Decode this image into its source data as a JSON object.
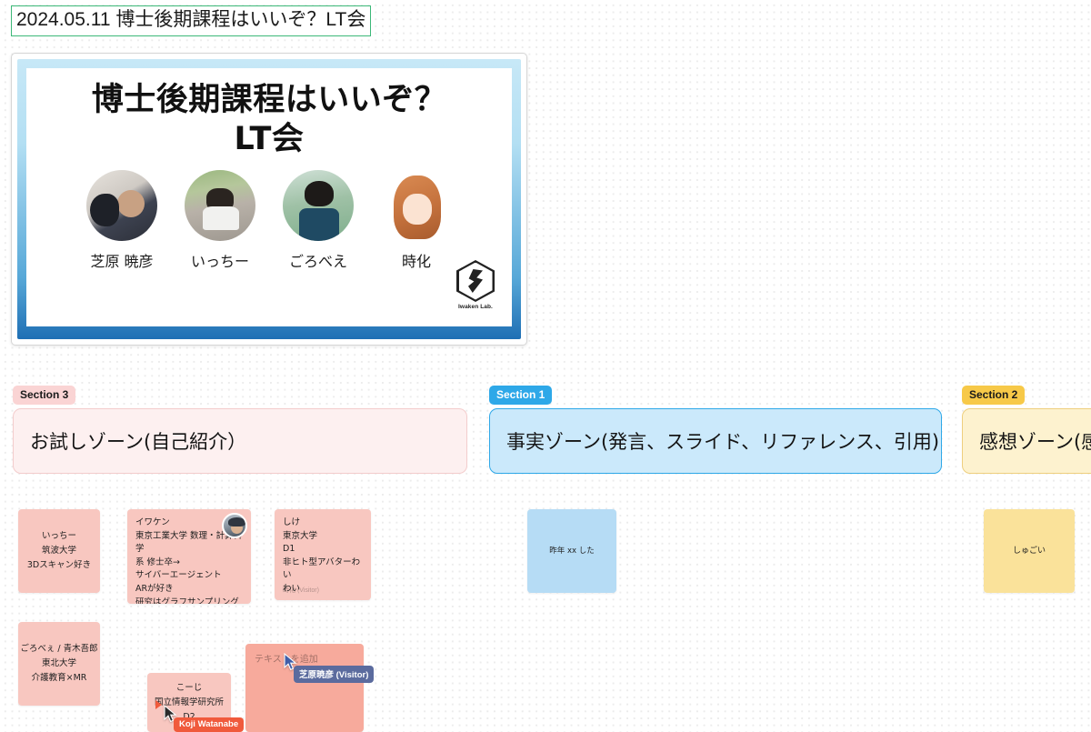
{
  "board": {
    "title": "2024.05.11 博士後期課程はいいぞ？LT会",
    "title_border_color": "#3cb878",
    "canvas_background": "#ffffff",
    "grid_dot_color": "#ececec"
  },
  "slide": {
    "title_line1": "博士後期課程はいいぞ？",
    "title_line2": "LT会",
    "frame_color": "#1f6fb4",
    "people": [
      {
        "name": "芝原 暁彦",
        "avatar_icon": "photo-avatar-shibahara"
      },
      {
        "name": "いっちー",
        "avatar_icon": "photo-avatar-icchi"
      },
      {
        "name": "ごろべえ",
        "avatar_icon": "photo-avatar-gorobe"
      },
      {
        "name": "時化",
        "avatar_icon": "illustration-avatar-shike"
      }
    ],
    "logo": {
      "name": "Iwaken Lab.",
      "icon": "iwaken-lab-hexagon-logo"
    }
  },
  "sections": [
    {
      "tag": "Section 3",
      "tag_color": "#fad4d4",
      "zone_label": "お試しゾーン(自己紹介）",
      "zone_fill": "#fdf0f0",
      "zone_border": "#f3cccc"
    },
    {
      "tag": "Section 1",
      "tag_color": "#2ea8e8",
      "zone_label": "事実ゾーン(発言、スライド、リファレンス、引用)",
      "zone_fill": "#cbe9fb",
      "zone_border": "#2ea8e8"
    },
    {
      "tag": "Section 2",
      "tag_color": "#f7c948",
      "zone_label": "感想ゾーン(感",
      "zone_fill": "#fdf2cf",
      "zone_border": "#eecf7e"
    }
  ],
  "notes": {
    "icchi": {
      "text": "いっちー\n筑波大学\n3Dスキャン好き",
      "color": "#f8c7c0"
    },
    "iwaken": {
      "text": "イワケン\n東京工業大学 数理・計算科学\n系 修士卒→\nサイバーエージェント\nARが好き\n研究はグラフサンプリング\n研究はプチ挫折で会社員に！",
      "color": "#f8c7c0",
      "avatar_icon": "iwaken-profile-avatar"
    },
    "shike": {
      "text": "しけ\n東京大学\nD1\n非ヒト型アバターわい\nわい",
      "author": "時化 (Visitor)",
      "color": "#f8c7c0"
    },
    "gorobe": {
      "text": "ごろべぇ / 青木吾郎\n東北大学\n介護教育×MR",
      "color": "#f8c7c0"
    },
    "koji": {
      "text": "こーじ\n国立情報学研究所\nD2",
      "color": "#f8c7c0"
    },
    "new_text": {
      "placeholder": "テキストを追加",
      "color": "#f7aa9c"
    },
    "sakunen": {
      "text": "昨年 xx した",
      "color": "#b6dcf5"
    },
    "sugoi": {
      "text": "しゅごい",
      "color": "#fae29a"
    }
  },
  "cursors": [
    {
      "label": "芝原暁彦 (Visitor)",
      "color": "#5b6b9e",
      "icon": "pointer-cursor"
    },
    {
      "label": "Koji Watanabe",
      "color": "#f05a3c",
      "icon": "pointer-cursor"
    }
  ]
}
